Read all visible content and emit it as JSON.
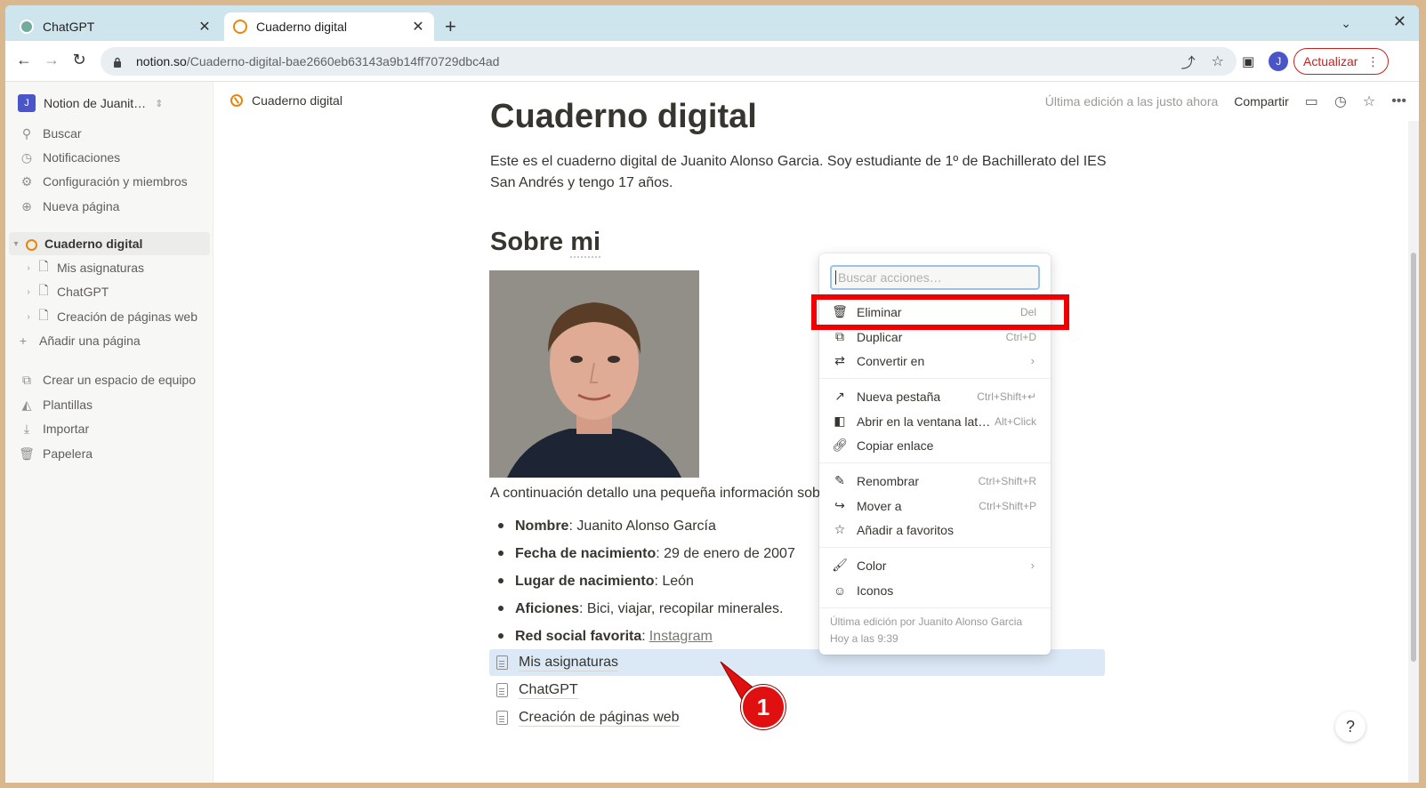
{
  "browser": {
    "tabs": [
      {
        "title": "ChatGPT",
        "icon": "chatgpt-icon",
        "active": false
      },
      {
        "title": "Cuaderno digital",
        "icon": "compass-icon",
        "active": true
      }
    ],
    "new_tab": "+",
    "url_host": "notion.so",
    "url_path": "/Cuaderno-digital-bae2660eb63143a9b14ff70729dbc4ad",
    "profile_initial": "J",
    "update_label": "Actualizar"
  },
  "sidebar": {
    "workspace_initial": "J",
    "workspace_name": "Notion de Juanit…",
    "top_items": [
      {
        "label": "Buscar",
        "icon": "search-icon"
      },
      {
        "label": "Notificaciones",
        "icon": "clock-icon"
      },
      {
        "label": "Configuración y miembros",
        "icon": "gear-icon"
      },
      {
        "label": "Nueva página",
        "icon": "plus-circle-icon"
      }
    ],
    "pages": [
      {
        "label": "Cuaderno digital",
        "selected": true
      },
      {
        "label": "Mis asignaturas"
      },
      {
        "label": "ChatGPT"
      },
      {
        "label": "Creación de páginas web"
      }
    ],
    "add_page": "Añadir una página",
    "bottom_items": [
      {
        "label": "Crear un espacio de equipo",
        "icon": "team-icon"
      },
      {
        "label": "Plantillas",
        "icon": "shapes-icon"
      },
      {
        "label": "Importar",
        "icon": "download-icon"
      },
      {
        "label": "Papelera",
        "icon": "trash-icon"
      }
    ]
  },
  "header": {
    "breadcrumb": "Cuaderno digital",
    "last_edited": "Última edición a las justo ahora",
    "share": "Compartir"
  },
  "page": {
    "title": "Cuaderno digital",
    "intro": "Este es el cuaderno digital de Juanito Alonso Garcia. Soy estudiante de 1º de Bachillerato del IES San Andrés y tengo 17 años.",
    "section_title_a": "Sobre ",
    "section_title_b": "mi",
    "info_lead": "A continuación detallo una pequeña información sobre",
    "facts": [
      {
        "key": "Nombre",
        "value": ": Juanito Alonso García"
      },
      {
        "key": "Fecha de nacimiento",
        "value": ": 29 de enero de 2007"
      },
      {
        "key": "Lugar de nacimiento",
        "value": ": León"
      },
      {
        "key": "Aficiones",
        "value": ": Bici, viajar, recopilar minerales."
      },
      {
        "key": "Red social favorita",
        "value": ":",
        "link": "Instagram"
      }
    ],
    "subpages": [
      "Mis asignaturas",
      "ChatGPT",
      "Creación de páginas web"
    ]
  },
  "menu": {
    "search_placeholder": "Buscar acciones…",
    "items": [
      {
        "label": "Eliminar",
        "shortcut": "Del",
        "icon": "trash-icon"
      },
      {
        "label": "Duplicar",
        "shortcut": "Ctrl+D",
        "icon": "duplicate-icon"
      },
      {
        "label": "Convertir en",
        "shortcut": "",
        "icon": "convert-icon",
        "submenu": true
      },
      {
        "label": "Nueva pestaña",
        "shortcut": "Ctrl+Shift+↵",
        "icon": "arrow-up-right-icon"
      },
      {
        "label": "Abrir en la ventana lat…",
        "shortcut": "Alt+Click",
        "icon": "side-panel-icon"
      },
      {
        "label": "Copiar enlace",
        "shortcut": "",
        "icon": "link-icon"
      },
      {
        "label": "Renombrar",
        "shortcut": "Ctrl+Shift+R",
        "icon": "edit-icon"
      },
      {
        "label": "Mover a",
        "shortcut": "Ctrl+Shift+P",
        "icon": "move-icon"
      },
      {
        "label": "Añadir a favoritos",
        "shortcut": "",
        "icon": "star-icon"
      },
      {
        "label": "Color",
        "shortcut": "",
        "icon": "paint-icon",
        "submenu": true
      },
      {
        "label": "Iconos",
        "shortcut": "",
        "icon": "smile-icon"
      }
    ],
    "footer_line1": "Última edición por Juanito Alonso Garcia",
    "footer_line2": "Hoy a las 9:39"
  },
  "annotation": {
    "badge": "1",
    "color": "#f00000"
  },
  "help": "?"
}
